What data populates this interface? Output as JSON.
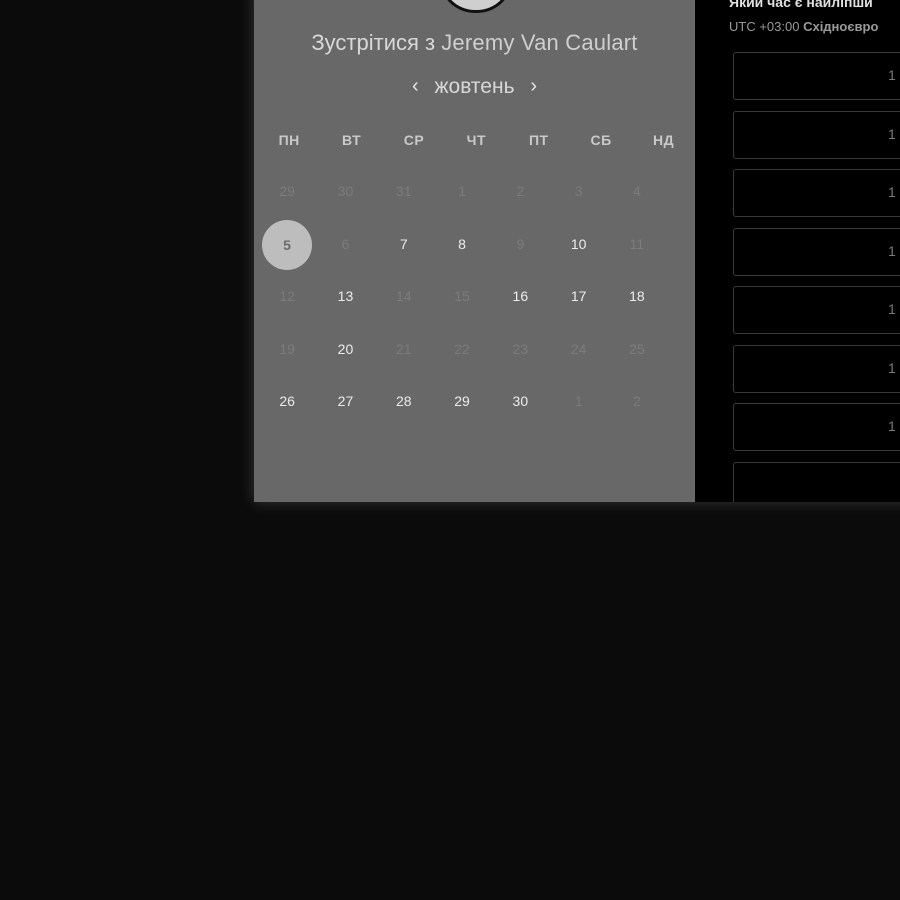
{
  "meeting": {
    "title_prefix": "Зустрітися з",
    "host_name": "Jeremy Van Caulart"
  },
  "calendar": {
    "month": "жовтень",
    "prev_icon": "chevron-left-icon",
    "next_icon": "chevron-right-icon",
    "weekdays": [
      "ПН",
      "ВТ",
      "СР",
      "ЧТ",
      "ПТ",
      "СБ",
      "НД"
    ],
    "selected_day": "5",
    "weeks": [
      [
        {
          "d": "29",
          "a": false
        },
        {
          "d": "30",
          "a": false
        },
        {
          "d": "31",
          "a": false
        },
        {
          "d": "1",
          "a": false
        },
        {
          "d": "2",
          "a": false
        },
        {
          "d": "3",
          "a": false
        },
        {
          "d": "4",
          "a": false
        }
      ],
      [
        {
          "d": "5",
          "a": true,
          "sel": true
        },
        {
          "d": "6",
          "a": false
        },
        {
          "d": "7",
          "a": true
        },
        {
          "d": "8",
          "a": true
        },
        {
          "d": "9",
          "a": false
        },
        {
          "d": "10",
          "a": true
        },
        {
          "d": "11",
          "a": false
        }
      ],
      [
        {
          "d": "12",
          "a": false
        },
        {
          "d": "13",
          "a": true
        },
        {
          "d": "14",
          "a": false
        },
        {
          "d": "15",
          "a": false
        },
        {
          "d": "16",
          "a": true
        },
        {
          "d": "17",
          "a": true
        },
        {
          "d": "18",
          "a": true
        }
      ],
      [
        {
          "d": "19",
          "a": false
        },
        {
          "d": "20",
          "a": true
        },
        {
          "d": "21",
          "a": false
        },
        {
          "d": "22",
          "a": false
        },
        {
          "d": "23",
          "a": false
        },
        {
          "d": "24",
          "a": false
        },
        {
          "d": "25",
          "a": false
        }
      ],
      [
        {
          "d": "26",
          "a": true
        },
        {
          "d": "27",
          "a": true
        },
        {
          "d": "28",
          "a": true
        },
        {
          "d": "29",
          "a": true
        },
        {
          "d": "30",
          "a": true
        },
        {
          "d": "1",
          "a": false
        },
        {
          "d": "2",
          "a": false
        }
      ]
    ]
  },
  "times": {
    "question": "Який час є найліпши",
    "tz_offset": "UTC +03:00",
    "tz_name": "Східноєвро",
    "slots": [
      "1",
      "1",
      "1",
      "1",
      "1",
      "1",
      "1",
      ""
    ]
  },
  "colors": {
    "left_panel": "#686868",
    "right_panel": "#000000",
    "backdrop": "#0b0b0b",
    "selected_day_bg": "#bdbdbd"
  }
}
